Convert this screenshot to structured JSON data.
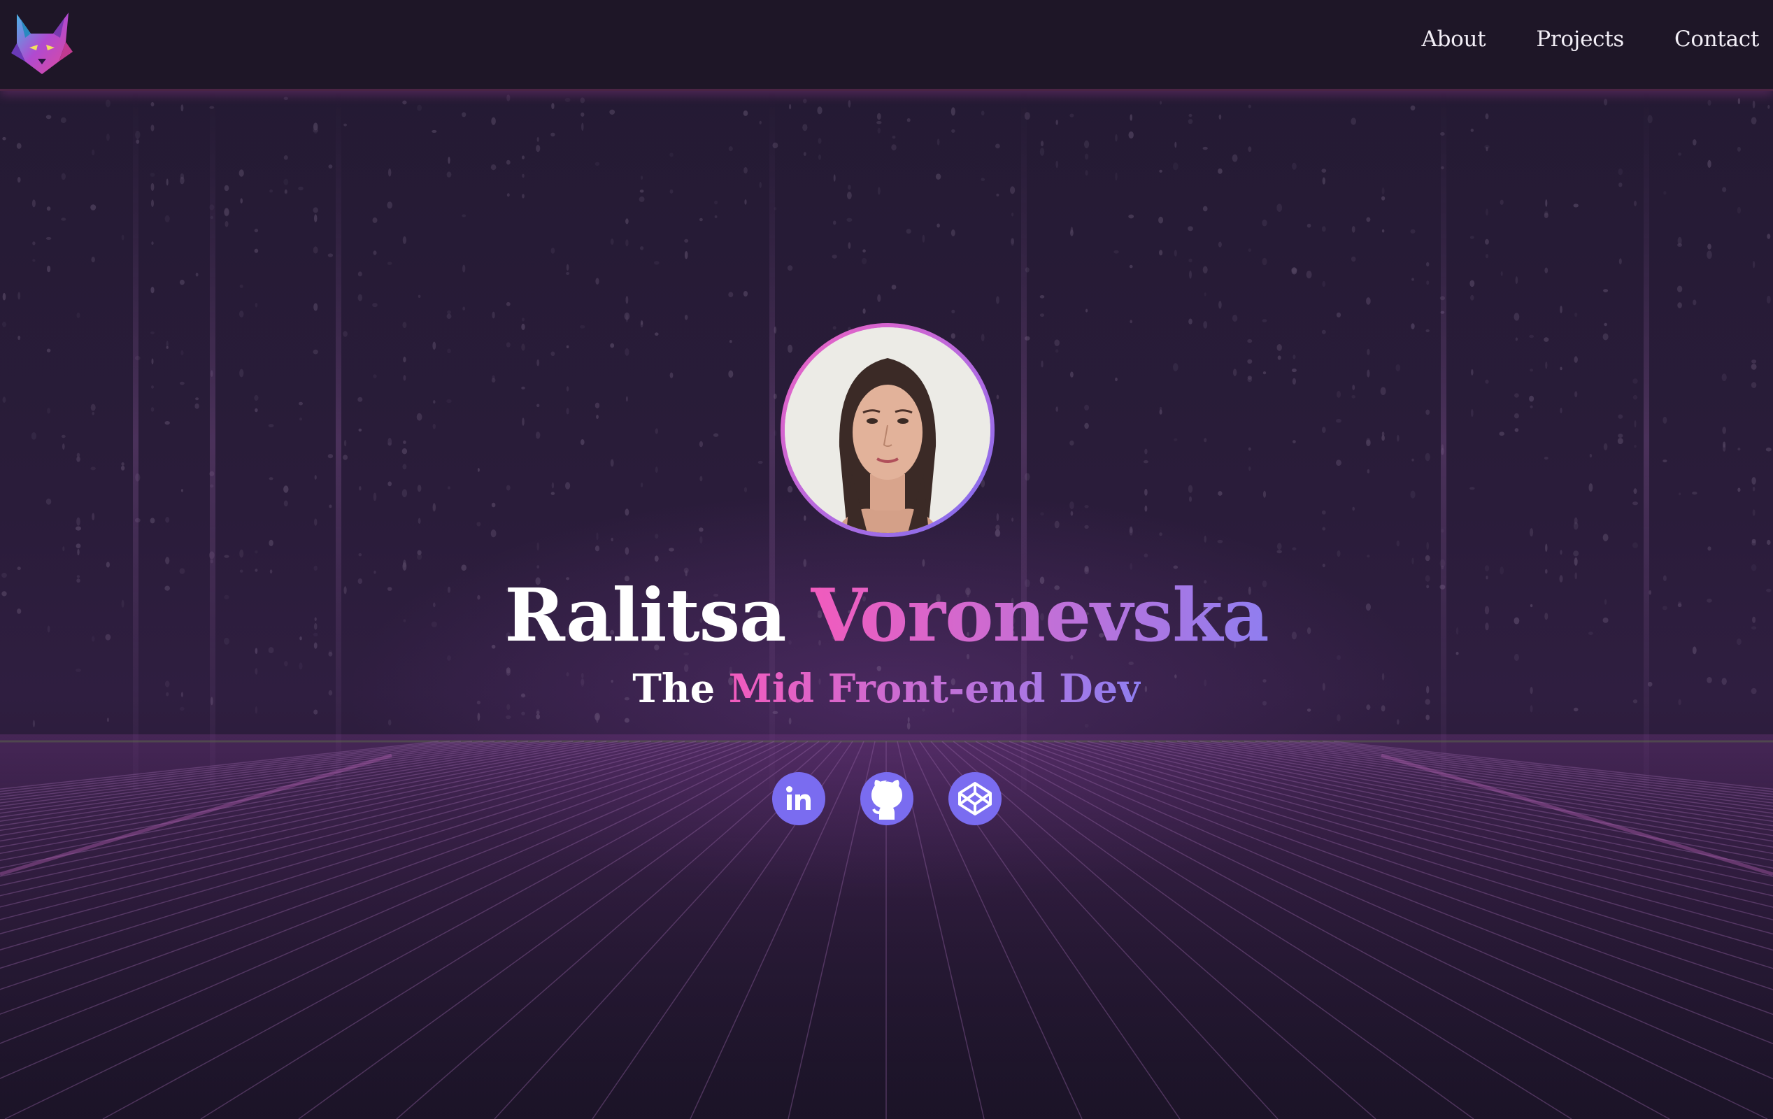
{
  "header": {
    "logo_icon": "lynx-logo-icon",
    "nav": [
      {
        "label": "About"
      },
      {
        "label": "Projects"
      },
      {
        "label": "Contact"
      }
    ]
  },
  "hero": {
    "avatar_icon": "profile-photo",
    "name_first": "Ralitsa",
    "name_last": "Voronevska",
    "subtitle_prefix": "The",
    "subtitle_role": "Mid Front-end Dev",
    "socials": [
      {
        "icon": "linkedin-icon"
      },
      {
        "icon": "github-icon"
      },
      {
        "icon": "codepen-icon"
      }
    ]
  },
  "colors": {
    "background": "#231a32",
    "header_bg": "#1e1627",
    "accent_pink": "#f15bbd",
    "accent_violet": "#8f7ef0",
    "social_bg": "#7a6cf0",
    "text": "#ffffff"
  }
}
